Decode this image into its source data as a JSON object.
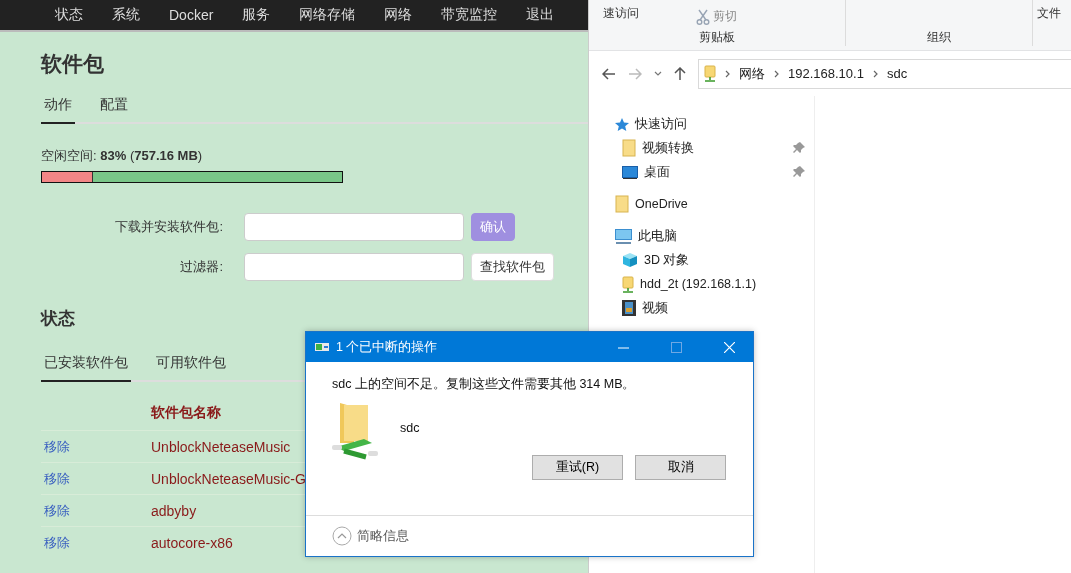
{
  "nav": [
    {
      "label": "状态"
    },
    {
      "label": "系统"
    },
    {
      "label": "Docker"
    },
    {
      "label": "服务"
    },
    {
      "label": "网络存储"
    },
    {
      "label": "网络"
    },
    {
      "label": "带宽监控"
    },
    {
      "label": "退出"
    }
  ],
  "page": {
    "title": "软件包",
    "tabs": [
      {
        "label": "动作",
        "selected": true
      },
      {
        "label": "配置",
        "selected": false
      }
    ],
    "free_space": {
      "label": "空闲空间: **83%** (**757.16 MB**)",
      "level": 0.83
    },
    "form": [
      {
        "label": "下载并安装软件包:",
        "button": "确认",
        "kind": "primary"
      },
      {
        "label": "过滤器:",
        "button": "查找软件包",
        "kind": "plain"
      }
    ],
    "status_title": "状态",
    "status_tabs": [
      {
        "label": "已安装软件包",
        "selected": true
      },
      {
        "label": "可用软件包",
        "selected": false
      }
    ],
    "table": {
      "columns": [
        "软件包名称"
      ],
      "rows": [
        {
          "action": "移除",
          "name": "UnblockNeteaseMusic"
        },
        {
          "action": "移除",
          "name": "UnblockNeteaseMusic-G"
        },
        {
          "action": "移除",
          "name": "adbyby"
        },
        {
          "action": "移除",
          "name": "autocore-x86"
        }
      ]
    }
  },
  "explorer": {
    "ribbon": {
      "quick_access": "速访问",
      "cut": "剪切",
      "clipboard_group": "剪贴板",
      "organize_group": "组织",
      "new_folder": "文件"
    },
    "breadcrumb": [
      "网络",
      "192.168.10.1",
      "sdc"
    ],
    "tree": [
      {
        "label": "快速访问",
        "kind": "star",
        "children": [
          {
            "label": "视频转换",
            "kind": "folder",
            "pinned": true
          },
          {
            "label": "桌面",
            "kind": "desktop",
            "pinned": true
          }
        ]
      },
      {
        "label": "OneDrive",
        "kind": "folder"
      },
      {
        "label": "此电脑",
        "kind": "pc",
        "children": [
          {
            "label": "3D 对象",
            "kind": "cube",
            "pinned": false
          },
          {
            "label": "hdd_2t (192.168.1.1)",
            "kind": "netdrive",
            "pinned": false
          },
          {
            "label": "视频",
            "kind": "video",
            "pinned": false
          }
        ]
      }
    ]
  },
  "dialog": {
    "title": "1 个已中断的操作",
    "message": "sdc 上的空间不足。复制这些文件需要其他 314 MB。",
    "item": "sdc",
    "buttons": [
      "重试(R)",
      "取消"
    ],
    "details": "简略信息"
  }
}
